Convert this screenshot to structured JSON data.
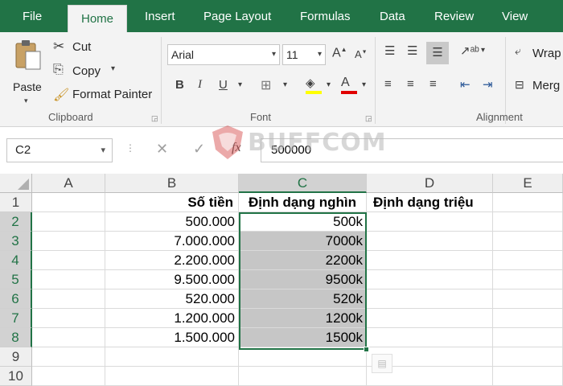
{
  "tabs": [
    "File",
    "Home",
    "Insert",
    "Page Layout",
    "Formulas",
    "Data",
    "Review",
    "View"
  ],
  "active_tab": "Home",
  "clipboard": {
    "paste_label": "Paste",
    "cut_label": "Cut",
    "copy_label": "Copy",
    "format_painter_label": "Format Painter",
    "group_label": "Clipboard"
  },
  "font": {
    "font_name": "Arial",
    "font_size": "11",
    "group_label": "Font"
  },
  "alignment": {
    "wrap_label": "Wrap",
    "merge_label": "Merg",
    "group_label": "Alignment"
  },
  "formula_bar": {
    "name_box": "C2",
    "formula": "500000"
  },
  "watermark": "BUFFCOM",
  "columns": [
    "A",
    "B",
    "C",
    "D",
    "E"
  ],
  "rows": [
    "1",
    "2",
    "3",
    "4",
    "5",
    "6",
    "7",
    "8",
    "9",
    "10"
  ],
  "headers": {
    "b": "Số tiền",
    "c": "Định dạng nghìn",
    "d": "Định dạng triệu"
  },
  "values_b": [
    "500.000",
    "7.000.000",
    "2.200.000",
    "9.500.000",
    "520.000",
    "1.200.000",
    "1.500.000"
  ],
  "values_c": [
    "500k",
    "7000k",
    "2200k",
    "9500k",
    "520k",
    "1200k",
    "1500k"
  ],
  "colors": {
    "accent": "#217346",
    "selection_fill": "#c6c6c6"
  }
}
